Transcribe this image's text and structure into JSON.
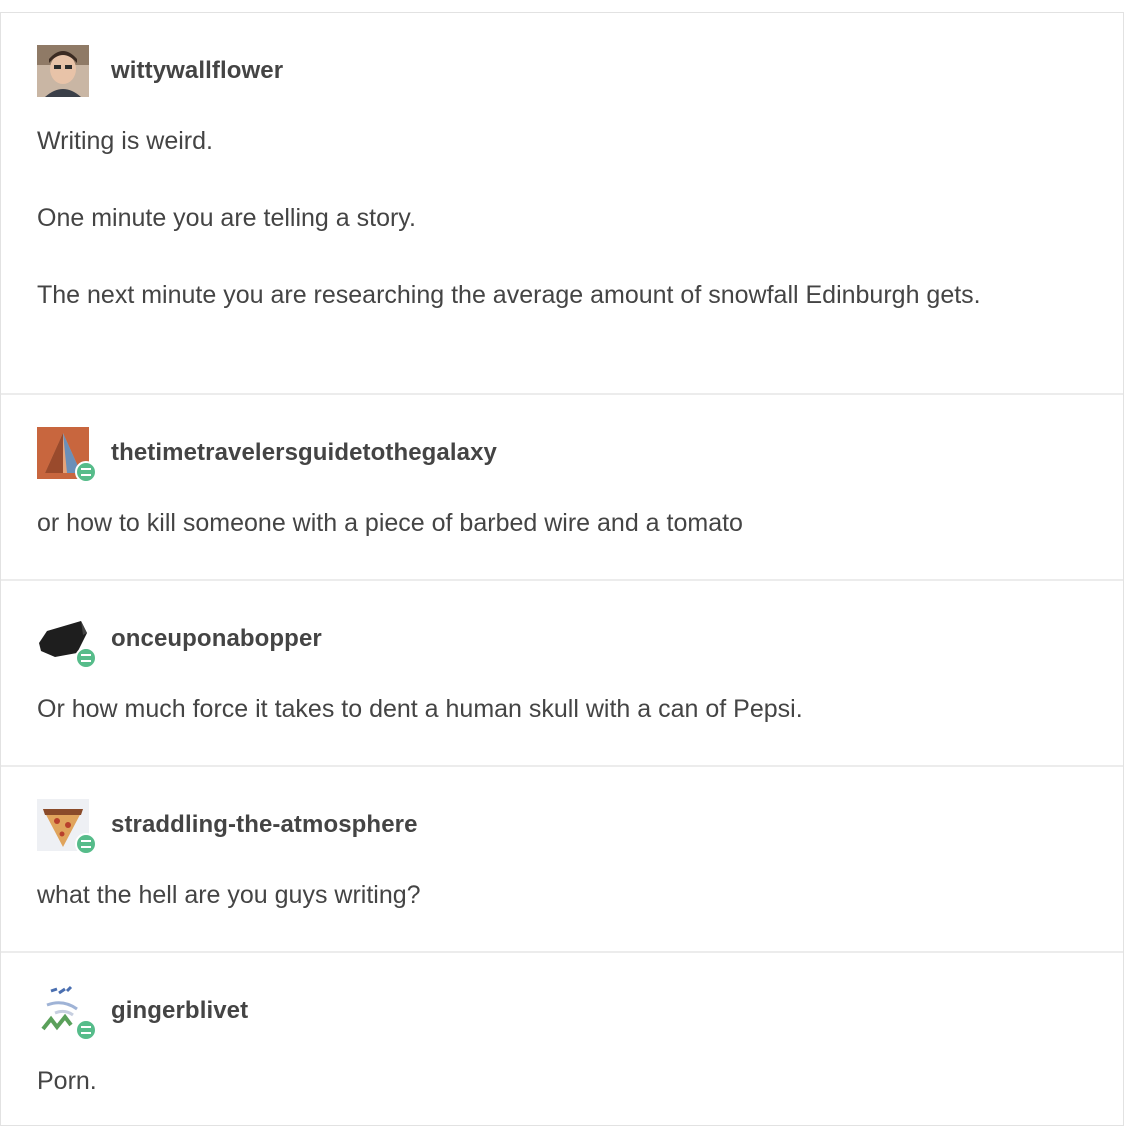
{
  "posts": [
    {
      "username": "wittywallflower",
      "avatar": "person-photo-icon",
      "reblog": false,
      "paragraphs": [
        "Writing is weird.",
        "One minute you are telling a story.",
        "The next minute you are researching the average amount of snowfall Edinburgh gets."
      ]
    },
    {
      "username": "thetimetravelersguidetothegalaxy",
      "avatar": "triangle-art-icon",
      "reblog": true,
      "paragraphs": [
        "or how to kill someone with a piece of barbed wire and a tomato"
      ]
    },
    {
      "username": "onceuponabopper",
      "avatar": "dark-shape-icon",
      "reblog": true,
      "paragraphs": [
        "Or how much force it takes to dent a human skull with a can of Pepsi."
      ]
    },
    {
      "username": "straddling-the-atmosphere",
      "avatar": "pizza-slice-icon",
      "reblog": true,
      "paragraphs": [
        "what the hell are you guys writing?"
      ]
    },
    {
      "username": "gingerblivet",
      "avatar": "sketch-art-icon",
      "reblog": true,
      "paragraphs": [
        "Porn."
      ]
    }
  ],
  "colors": {
    "text": "#444444",
    "divider": "#ececec",
    "reblog_badge": "#56bc8a"
  }
}
